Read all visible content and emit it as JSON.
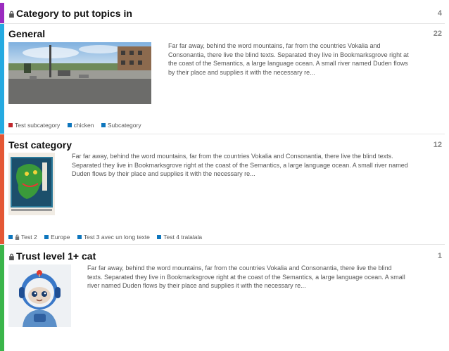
{
  "categories": [
    {
      "title": "Category to put topics in",
      "count": "4",
      "locked": true,
      "color": "#9b2bbf"
    },
    {
      "title": "General",
      "count": "22",
      "color": "#25aae1",
      "description": "Far far away, behind the word mountains, far from the countries Vokalia and Consonantia, there live the blind texts. Separated they live in Bookmarksgrove right at the coast of the Semantics, a large language ocean. A small river named Duden flows by their place and supplies it with the necessary re...",
      "subcategories": [
        {
          "label": "Test subcategory",
          "color": "#c0272d"
        },
        {
          "label": "chicken",
          "color": "#0e76bd"
        },
        {
          "label": "Subcategory",
          "color": "#0e76bd"
        }
      ]
    },
    {
      "title": "Test category",
      "count": "12",
      "color": "#e45735",
      "description": "Far far away, behind the word mountains, far from the countries Vokalia and Consonantia, there live the blind texts. Separated they live in Bookmarksgrove right at the coast of the Semantics, a large language ocean. A small river named Duden flows by their place and supplies it with the necessary re...",
      "subcategories": [
        {
          "label": "Test 2",
          "color": "#0e76bd",
          "locked": true
        },
        {
          "label": "Europe",
          "color": "#0e76bd"
        },
        {
          "label": "Test 3 avec un long texte",
          "color": "#0e76bd"
        },
        {
          "label": "Test 4 tralalala",
          "color": "#0e76bd"
        }
      ]
    },
    {
      "title": "Trust level 1+ cat",
      "count": "1",
      "locked": true,
      "color": "#3ab54a",
      "description": "Far far away, behind the word mountains, far from the countries Vokalia and Consonantia, there live the blind texts. Separated they live in Bookmarksgrove right at the coast of the Semantics, a large language ocean. A small river named Duden flows by their place and supplies it with the necessary re..."
    }
  ]
}
